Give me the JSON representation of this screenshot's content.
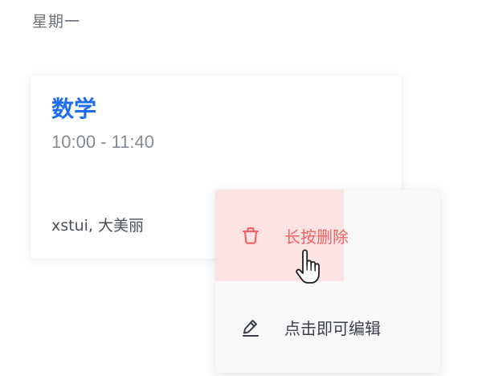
{
  "day": {
    "label": "星期一"
  },
  "course": {
    "title": "数学",
    "time": "10:00 - 11:40",
    "teachers": "xstui, 大美丽"
  },
  "context_menu": {
    "items": [
      {
        "label": "长按删除",
        "icon": "trash-icon",
        "color": "#f16464"
      },
      {
        "label": "点击即可编辑",
        "icon": "pencil-icon",
        "color": "#3b3f49"
      }
    ]
  },
  "colors": {
    "title": "#1d6cf2",
    "delete": "#f16464",
    "press_highlight": "#fbe3e3"
  }
}
